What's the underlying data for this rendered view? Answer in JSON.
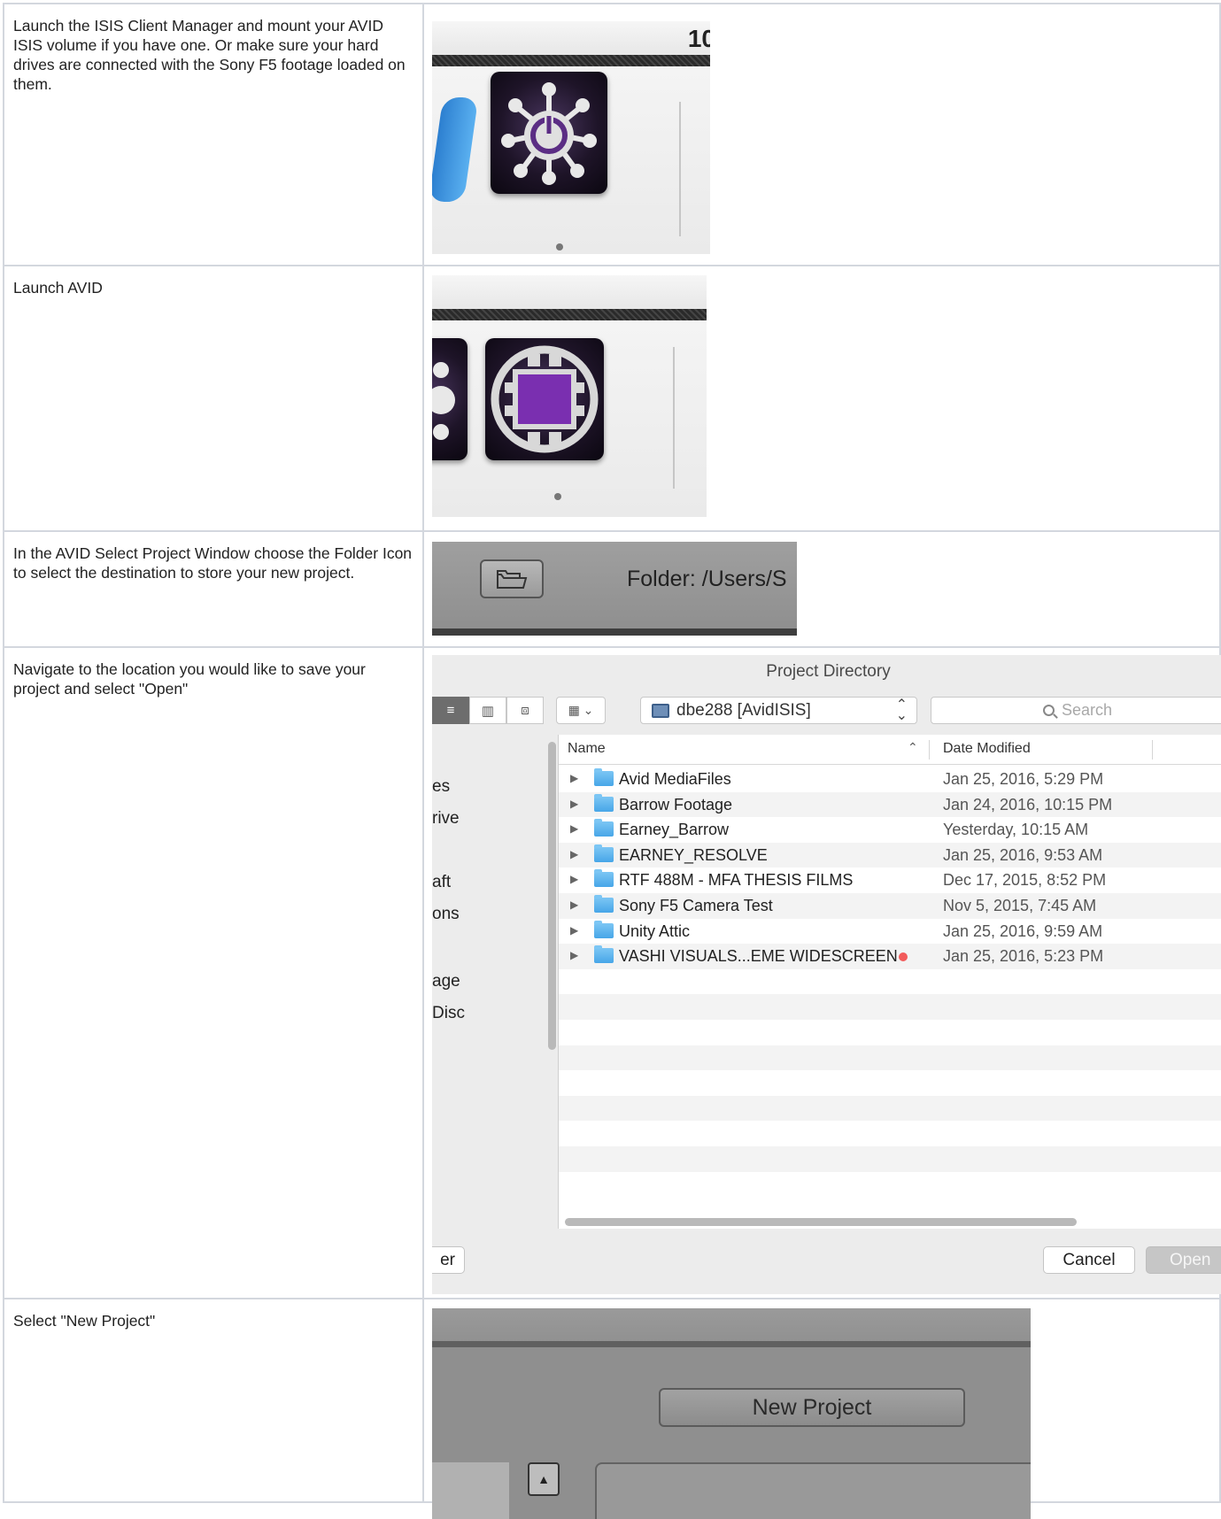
{
  "steps": [
    {
      "text": "Launch the ISIS Client Manager and mount your AVID ISIS volume if you have one. Or make sure your hard drives are connected with the Sony F5 footage loaded on them.",
      "screenshot": {
        "dock_number": "10",
        "icon": "isis-client-icon"
      }
    },
    {
      "text": "Launch AVID",
      "screenshot": {
        "icon": "avid-media-composer-icon"
      }
    },
    {
      "text": "In the AVID Select Project Window choose the Folder Icon to select the destination to store your new project.",
      "screenshot": {
        "folder_label": "Folder: /Users/S",
        "icon": "folder-icon"
      }
    },
    {
      "text": "Navigate to the location you would like to save your project and select \"Open\"",
      "screenshot": {
        "title": "Project Directory",
        "location": "dbe288 [AvidISIS]",
        "search_placeholder": "Search",
        "sidebar_items": [
          "es",
          "rive",
          "aft",
          "ons",
          "age",
          "Disc"
        ],
        "columns": {
          "name": "Name",
          "date": "Date Modified"
        },
        "rows": [
          {
            "name": "Avid MediaFiles",
            "date": "Jan 25, 2016, 5:29 PM"
          },
          {
            "name": "Barrow Footage",
            "date": "Jan 24, 2016, 10:15 PM"
          },
          {
            "name": "Earney_Barrow",
            "date": "Yesterday, 10:15 AM"
          },
          {
            "name": "EARNEY_RESOLVE",
            "date": "Jan 25, 2016, 9:53 AM"
          },
          {
            "name": "RTF 488M - MFA THESIS FILMS",
            "date": "Dec 17, 2015, 8:52 PM"
          },
          {
            "name": "Sony F5 Camera Test",
            "date": "Nov 5, 2015, 7:45 AM"
          },
          {
            "name": "Unity Attic",
            "date": "Jan 25, 2016, 9:59 AM"
          },
          {
            "name": "VASHI VISUALS...EME WIDESCREEN",
            "date": "Jan 25, 2016, 5:23 PM",
            "tag_color": "#f25a5a"
          }
        ],
        "buttons": {
          "new_folder": "er",
          "cancel": "Cancel",
          "open": "Open"
        }
      }
    },
    {
      "text": "Select \"New Project\"",
      "screenshot": {
        "button": "New Project"
      }
    }
  ]
}
